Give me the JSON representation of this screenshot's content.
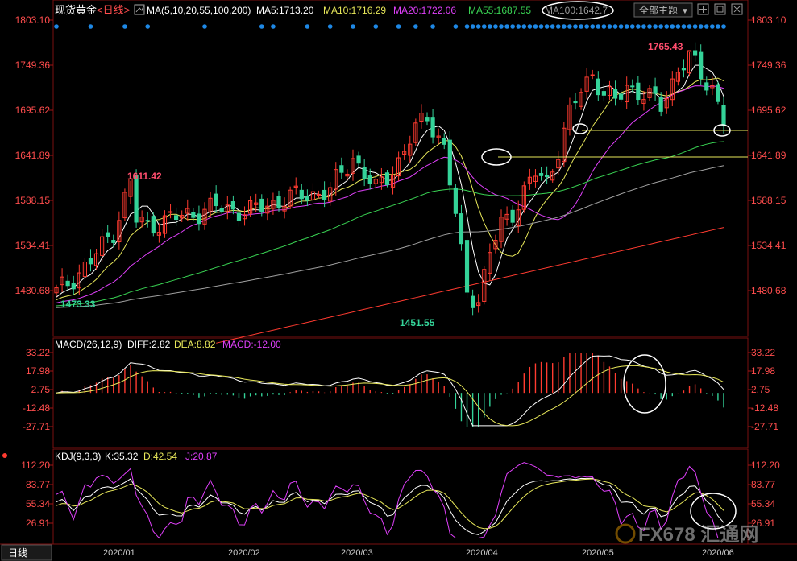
{
  "header": {
    "instrument": "现货黄金",
    "period": "<日线>",
    "ma_label": "MA(5,10,20,55,100,200)",
    "ma5": "MA5:1713.20",
    "ma10": "MA10:1716.29",
    "ma20": "MA20:1722.06",
    "ma55": "MA55:1687.55",
    "ma100": "MA100:1642.7",
    "theme_button": "全部主题",
    "theme_arrow": "▼"
  },
  "price_axis": {
    "ticks": [
      "1803.10",
      "1749.36",
      "1695.62",
      "1641.89",
      "1588.15",
      "1534.41",
      "1480.68"
    ],
    "values": [
      1803.1,
      1749.36,
      1695.62,
      1641.89,
      1588.15,
      1534.41,
      1480.68
    ]
  },
  "price_annotations": {
    "high_label": "1765.43",
    "early_high_label": "1611.42",
    "low_label": "1451.55",
    "start_low_label": "1473.33"
  },
  "macd": {
    "title": "MACD(26,12,9)",
    "diff": "DIFF:2.82",
    "dea": "DEA:8.82",
    "macd": "MACD:-12.00",
    "ticks": [
      "33.22",
      "17.98",
      "2.75",
      "-12.48",
      "-27.71"
    ],
    "values": [
      33.22,
      17.98,
      2.75,
      -12.48,
      -27.71
    ]
  },
  "kdj": {
    "title": "KDJ(9,3,3)",
    "k": "K:35.32",
    "d": "D:42.54",
    "j": "J:20.87",
    "ticks": [
      "112.20",
      "83.77",
      "55.34",
      "26.91"
    ],
    "values": [
      112.2,
      83.77,
      55.34,
      26.91
    ]
  },
  "x_axis": {
    "period_button": "日线",
    "months": [
      "2020/01",
      "2020/02",
      "2020/03",
      "2020/04",
      "2020/05",
      "2020/06"
    ]
  },
  "watermark": "FX678 汇通网",
  "colors": {
    "up": "#ff3b30",
    "down": "#34d399",
    "ma5": "#ffffff",
    "ma10": "#e8e85a",
    "ma20": "#e040fb",
    "ma55": "#39d353",
    "ma100": "#a0a0a0",
    "ma200": "#ff3b30",
    "axis_text": "#ff4d4d",
    "dots": "#1e88e5"
  },
  "chart_data": {
    "type": "candlestick",
    "x_range": [
      "2019-12-23",
      "2020-06-05"
    ],
    "ylim": [
      1440,
      1810
    ],
    "key_levels": {
      "high": 1765.43,
      "early_high": 1611.42,
      "low": 1451.55,
      "start_low": 1473.33
    },
    "last_close_approx": 1684,
    "moving_averages": {
      "MA5": 1713.2,
      "MA10": 1716.29,
      "MA20": 1722.06,
      "MA55": 1687.55,
      "MA100": 1642.7
    },
    "macd_last": {
      "DIFF": 2.82,
      "DEA": 8.82,
      "MACD": -12.0
    },
    "kdj_last": {
      "K": 35.32,
      "D": 42.54,
      "J": 20.87
    }
  }
}
